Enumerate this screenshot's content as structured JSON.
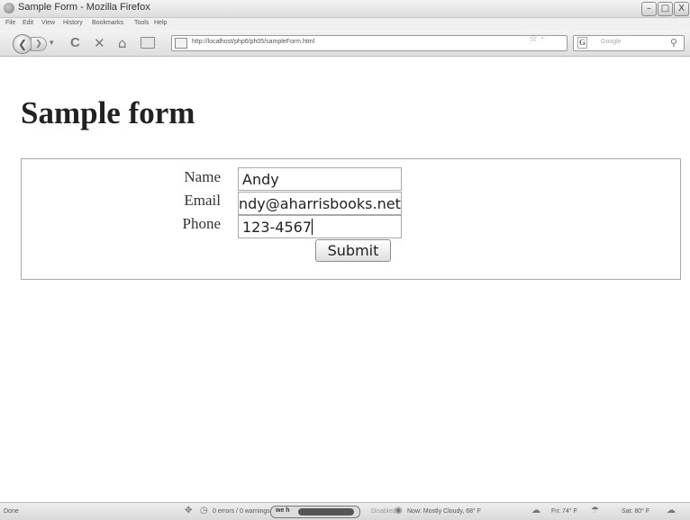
{
  "window": {
    "title": "Sample Form - Mozilla Firefox",
    "controls": {
      "minimize": "–",
      "maximize": "□",
      "close": "X"
    }
  },
  "menubar": {
    "items": [
      "File",
      "Edit",
      "View",
      "History",
      "Bookmarks",
      "Tools",
      "Help"
    ]
  },
  "navbar": {
    "back_glyph": "❮",
    "forward_glyph": "❯",
    "dropdown_glyph": "▾",
    "reload_glyph": "C",
    "stop_glyph": "✕",
    "home_glyph": "⌂",
    "url": "http://localhost/php6/ph05/sampleForm.html",
    "star_glyph": "☆ ·",
    "search_engine": "G",
    "search_placeholder": "Google",
    "search_glyph": "⚲"
  },
  "page": {
    "heading": "Sample form",
    "form": {
      "fields": [
        {
          "label": "Name",
          "value": "Andy"
        },
        {
          "label": "Email",
          "value": "ndy@aharrisbooks.net"
        },
        {
          "label": "Phone",
          "value": "123-4567"
        }
      ],
      "submit_label": "Submit"
    }
  },
  "statusbar": {
    "status": "Done",
    "errors": "0 errors / 0 warnings",
    "webdev_label": "we h",
    "disabled": "Disabled",
    "weather_now": "Now: Mostly Cloudy, 68° F",
    "weather_fri": "Fri: 74° F",
    "weather_sat": "Sat: 80° F"
  }
}
